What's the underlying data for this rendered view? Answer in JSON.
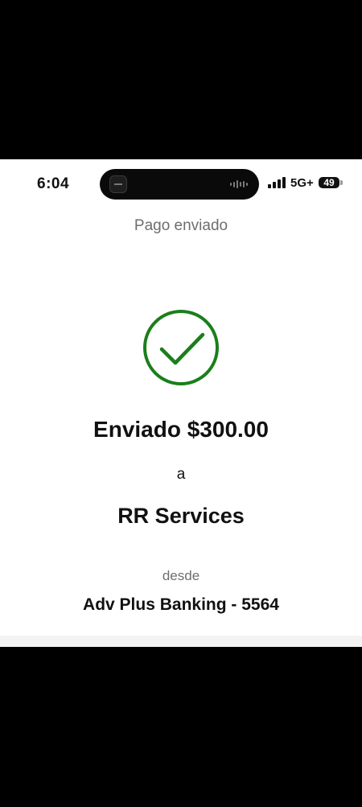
{
  "status_bar": {
    "time": "6:04",
    "network": "5G+",
    "battery": "49",
    "signal_bars": 4
  },
  "header": {
    "title": "Pago enviado"
  },
  "confirmation": {
    "icon": "check-circle-icon",
    "icon_color": "#1a7f1a",
    "sent_amount": "Enviado $300.00",
    "to_word": "a",
    "recipient": "RR Services",
    "from_word": "desde",
    "account": "Adv Plus Banking - 5564"
  }
}
